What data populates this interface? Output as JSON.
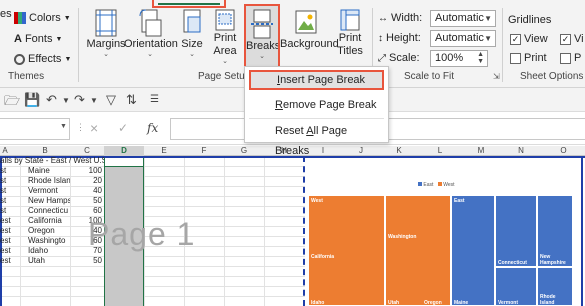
{
  "ribbon": {
    "themes": {
      "colors": "Colors",
      "fonts": "Fonts",
      "effects": "Effects",
      "partial_label": "es",
      "group_label": "Themes"
    },
    "page_setup": {
      "margins": "Margins",
      "orientation": "Orientation",
      "size": "Size",
      "print_area_l1": "Print",
      "print_area_l2": "Area",
      "breaks": "Breaks",
      "background": "Background",
      "print_titles_l1": "Print",
      "print_titles_l2": "Titles",
      "group_label": "Page Setup"
    },
    "scale_to_fit": {
      "width_label": "Width:",
      "width_value": "Automatic",
      "height_label": "Height:",
      "height_value": "Automatic",
      "scale_label": "Scale:",
      "scale_value": "100%",
      "group_label": "Scale to Fit"
    },
    "sheet_options": {
      "gridlines": "Gridlines",
      "view": "View",
      "print": "Print",
      "partial_view": "Vi",
      "partial_print": "P",
      "group_label": "Sheet Options"
    }
  },
  "breaks_menu": {
    "items": [
      {
        "label": "Insert Page Break",
        "underline_char": "I",
        "rest": "nsert Page Break"
      },
      {
        "label": "Remove Page Break",
        "underline_char": "R",
        "rest": "emove Page Break"
      },
      {
        "label": "Reset All Page Breaks",
        "pre": "Reset ",
        "underline_char": "A",
        "rest": "ll Page Breaks"
      }
    ]
  },
  "formula_bar": {
    "fx": "fx",
    "cancel": "×",
    "confirm": "✓"
  },
  "columns": [
    "A",
    "B",
    "C",
    "D",
    "E",
    "F",
    "G",
    "H",
    "I",
    "J",
    "K",
    "L",
    "M",
    "N",
    "O"
  ],
  "sheet": {
    "title": "alls by State - East / West U.S.",
    "rows": [
      {
        "a": "st",
        "b": "Maine",
        "c": "100"
      },
      {
        "a": "st",
        "b": "Rhode Islan",
        "c": "20"
      },
      {
        "a": "st",
        "b": "Vermont",
        "c": "40"
      },
      {
        "a": "st",
        "b": "New Hamps",
        "c": "50"
      },
      {
        "a": "st",
        "b": "Connecticu",
        "c": "60"
      },
      {
        "a": "est",
        "b": "California",
        "c": "100"
      },
      {
        "a": "est",
        "b": "Oregon",
        "c": "40"
      },
      {
        "a": "est",
        "b": "Washingto",
        "c": "60"
      },
      {
        "a": "est",
        "b": "Idaho",
        "c": "70"
      },
      {
        "a": "est",
        "b": "Utah",
        "c": "50"
      }
    ],
    "watermark": "Page 1"
  },
  "treemap": {
    "legend": [
      {
        "name": "East",
        "color": "#4472c4"
      },
      {
        "name": "West",
        "color": "#ed7d31"
      }
    ],
    "tiles": {
      "west": "West",
      "california": "California",
      "idaho": "Idaho",
      "washington": "Washington",
      "utah": "Utah",
      "oregon": "Oregon",
      "east": "East",
      "maine": "Maine",
      "connecticut": "Connecticut",
      "new_hampshire": "New Hampshire",
      "vermont": "Vermont",
      "rhode_island": "Rhode Island"
    }
  },
  "colors": {
    "accent": "#e8553d",
    "east": "#4472c4",
    "west": "#ed7d31",
    "page_break": "#1f3ea8",
    "selected_col": "#c8c8c8"
  }
}
